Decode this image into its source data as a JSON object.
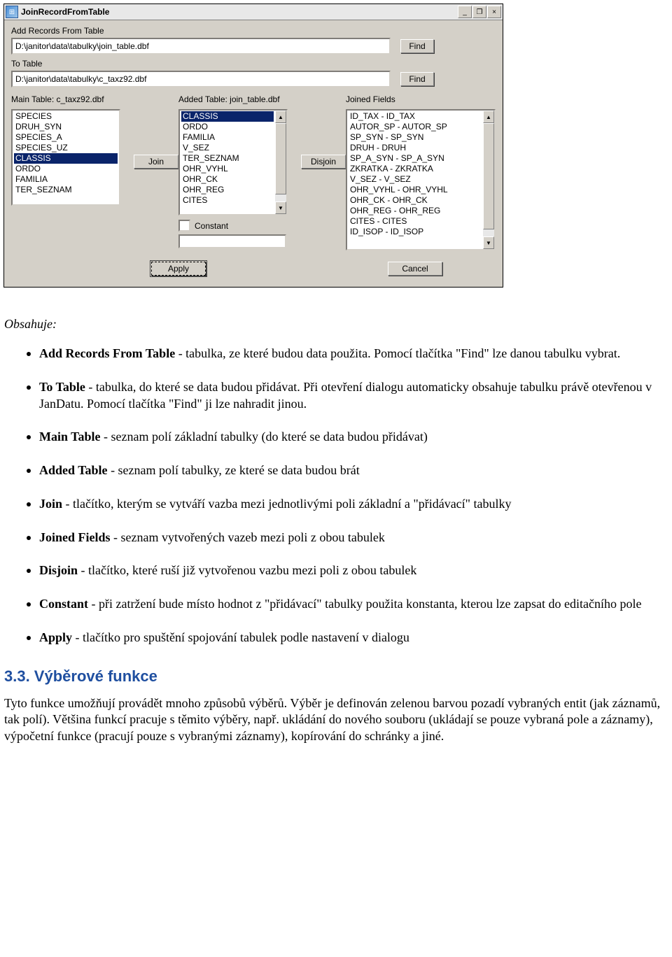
{
  "dialog": {
    "title": "JoinRecordFromTable",
    "window_controls": {
      "minimize": "_",
      "restore": "❐",
      "close": "×"
    },
    "add_label": "Add Records From Table",
    "add_value": "D:\\janitor\\data\\tabulky\\join_table.dbf",
    "to_label": "To Table",
    "to_value": "D:\\janitor\\data\\tabulky\\c_taxz92.dbf",
    "find_label": "Find",
    "main_table_label": "Main Table: c_taxz92.dbf",
    "added_table_label": "Added Table: join_table.dbf",
    "joined_fields_label": "Joined Fields",
    "join_label": "Join",
    "disjoin_label": "Disjoin",
    "constant_label": "Constant",
    "apply_label": "Apply",
    "cancel_label": "Cancel",
    "main_table_items": [
      "SPECIES",
      "DRUH_SYN",
      "SPECIES_A",
      "SPECIES_UZ",
      "CLASSIS",
      "ORDO",
      "FAMILIA",
      "TER_SEZNAM"
    ],
    "main_table_selected": "CLASSIS",
    "added_table_items": [
      "CLASSIS",
      "ORDO",
      "FAMILIA",
      "V_SEZ",
      "TER_SEZNAM",
      "OHR_VYHL",
      "OHR_CK",
      "OHR_REG",
      "CITES"
    ],
    "added_table_selected": "CLASSIS",
    "joined_fields_items": [
      "ID_TAX - ID_TAX",
      "AUTOR_SP - AUTOR_SP",
      "SP_SYN - SP_SYN",
      "DRUH - DRUH",
      "SP_A_SYN - SP_A_SYN",
      "ZKRATKA - ZKRATKA",
      "V_SEZ - V_SEZ",
      "OHR_VYHL - OHR_VYHL",
      "OHR_CK - OHR_CK",
      "OHR_REG - OHR_REG",
      "CITES - CITES",
      "ID_ISOP - ID_ISOP"
    ]
  },
  "doc": {
    "contains": "Obsahuje:",
    "items": [
      {
        "term": "Add Records From Table",
        "text": " - tabulka, ze které budou data použita. Pomocí tlačítka \"Find\" lze danou tabulku vybrat."
      },
      {
        "term": "To Table",
        "text": " - tabulka, do které se data budou přidávat. Při otevření dialogu automaticky obsahuje tabulku právě otevřenou v JanDatu. Pomocí tlačítka \"Find\" ji lze nahradit jinou."
      },
      {
        "term": "Main Table",
        "text": " - seznam polí základní tabulky (do které se data budou přidávat)"
      },
      {
        "term": "Added Table",
        "text": " - seznam polí tabulky, ze které se data budou brát"
      },
      {
        "term": "Join",
        "text": " - tlačítko, kterým se vytváří vazba mezi jednotlivými poli základní a \"přidávací\" tabulky"
      },
      {
        "term": "Joined Fields",
        "text": " - seznam vytvořených vazeb mezi poli z obou tabulek"
      },
      {
        "term": "Disjoin",
        "text": " - tlačítko, které ruší již vytvořenou vazbu mezi poli z obou tabulek"
      },
      {
        "term": "Constant",
        "text": " - při zatržení bude místo hodnot z \"přidávací\" tabulky použita konstanta, kterou lze zapsat do editačního pole"
      },
      {
        "term": "Apply",
        "text": " - tlačítko pro spuštění spojování tabulek podle nastavení v dialogu"
      }
    ],
    "section_heading": "3.3. Výběrové funkce",
    "section_body": "Tyto funkce umožňují provádět mnoho způsobů výběrů. Výběr je definován zelenou barvou pozadí vybraných entit (jak záznamů, tak polí). Většina funkcí pracuje s těmito výběry, např. ukládání do nového souboru (ukládají se pouze vybraná pole a záznamy), výpočetní funkce (pracují pouze s vybranými záznamy), kopírování do schránky a jiné."
  }
}
